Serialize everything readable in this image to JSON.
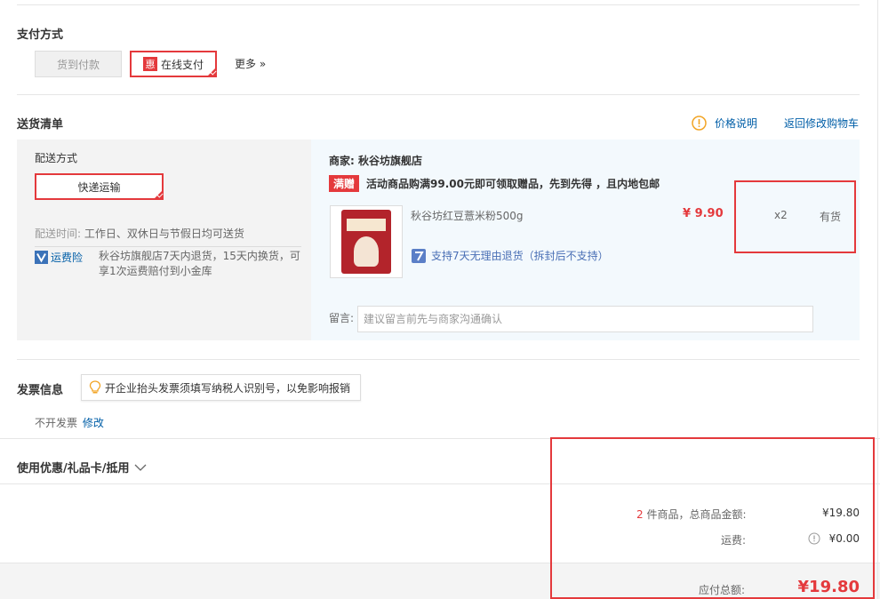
{
  "payment": {
    "title": "支付方式",
    "cod_label": "货到付款",
    "online_badge": "惠",
    "online_label": "在线支付",
    "more_label": "更多 »"
  },
  "delivery_list": {
    "title": "送货清单",
    "price_note": "价格说明",
    "back_to_cart": "返回修改购物车",
    "shipping": {
      "title": "配送方式",
      "method": "快递运输",
      "time_label": "配送时间:",
      "time_value": "工作日、双休日与节假日均可送货",
      "insurance_label": "运费险",
      "insurance_desc": "秋谷坊旗舰店7天内退货，15天内换货，可享1次运费赔付到小金库"
    },
    "shop": {
      "label": "商家:",
      "name": "秋谷坊旗舰店"
    },
    "promo": {
      "tag": "满赠",
      "text": "活动商品购满99.00元即可领取赠品，先到先得 ，且内地包邮"
    },
    "product": {
      "name": "秋谷坊红豆薏米粉500g",
      "price": "¥ 9.90",
      "qty": "x2",
      "stock": "有货",
      "return_policy": "支持7天无理由退货（拆封后不支持）"
    },
    "remark": {
      "label": "留言:",
      "placeholder": "建议留言前先与商家沟通确认"
    }
  },
  "invoice": {
    "title": "发票信息",
    "tip": "开企业抬头发票须填写纳税人识别号，以免影响报销",
    "value": "不开发票",
    "edit_label": "修改"
  },
  "coupon": {
    "title": "使用优惠/礼品卡/抵用"
  },
  "summary": {
    "item_count": "2",
    "items_label": "件商品，总商品金额:",
    "items_total": "¥19.80",
    "shipping_label": "运费:",
    "shipping_fee": "¥0.00",
    "payable_label": "应付总额:",
    "payable_total": "¥19.80"
  },
  "colors": {
    "accent": "#e4393c",
    "link": "#005ea7"
  }
}
